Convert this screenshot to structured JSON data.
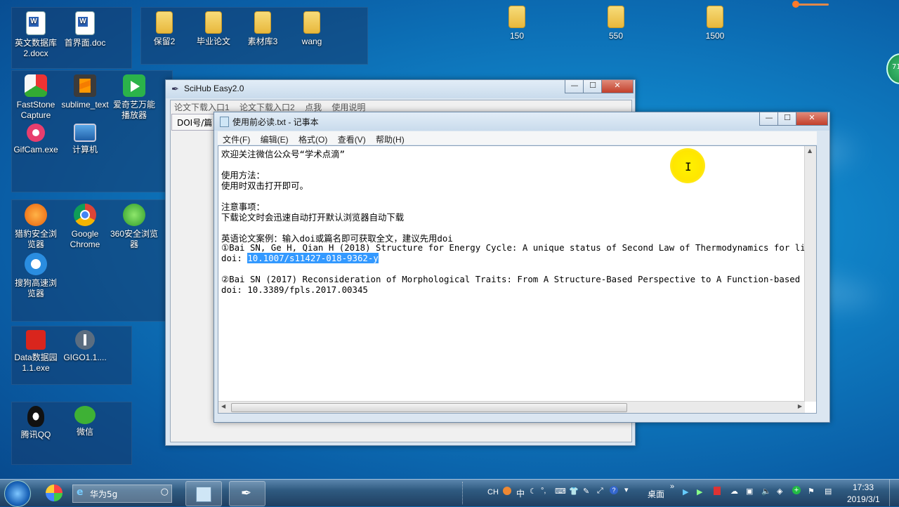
{
  "desktop": {
    "group1": [
      {
        "label_l1": "英文数据库",
        "label_l2": "2.docx",
        "icon": "word-doc-icon"
      },
      {
        "label_l1": "首界面.doc",
        "label_l2": "",
        "icon": "word-doc-icon"
      }
    ],
    "group2": [
      {
        "label": "保留2",
        "icon": "folder-icon"
      },
      {
        "label": "毕业论文",
        "icon": "folder-icon"
      },
      {
        "label": "素材库3",
        "icon": "folder-icon"
      },
      {
        "label": "wang",
        "icon": "folder-icon"
      }
    ],
    "loose_folders": [
      "150",
      "550",
      "1500"
    ],
    "group3": [
      {
        "label_l1": "FastStone",
        "label_l2": "Capture",
        "icon": "faststone-icon"
      },
      {
        "label_l1": "sublime_text",
        "label_l2": "",
        "icon": "sublime-icon"
      },
      {
        "label_l1": "爱奇艺万能",
        "label_l2": "播放器",
        "icon": "iqiyi-icon"
      },
      {
        "label_l1": "GifCam.exe",
        "label_l2": "",
        "icon": "gifcam-icon"
      },
      {
        "label_l1": "计算机",
        "label_l2": "",
        "icon": "computer-icon"
      }
    ],
    "group4": [
      {
        "label_l1": "猎豹安全浏",
        "label_l2": "览器",
        "icon": "liebao-icon"
      },
      {
        "label_l1": "Google",
        "label_l2": "Chrome",
        "icon": "chrome-icon"
      },
      {
        "label_l1": "360安全浏览",
        "label_l2": "器",
        "icon": "360-icon"
      },
      {
        "label_l1": "搜狗高速浏",
        "label_l2": "览器",
        "icon": "sogou-icon"
      }
    ],
    "group5": [
      {
        "label_l1": "Data数据园",
        "label_l2": "1.1.exe",
        "icon": "data-icon"
      },
      {
        "label_l1": "GIGO1.1....",
        "label_l2": "",
        "icon": "gigo-icon"
      }
    ],
    "group6": [
      {
        "label_l1": "腾讯QQ",
        "label_l2": "",
        "icon": "qq-icon"
      },
      {
        "label_l1": "微信",
        "label_l2": "",
        "icon": "wechat-icon"
      }
    ],
    "badge": "71"
  },
  "scihub": {
    "title": "SciHub Easy2.0",
    "menu": [
      "论文下载入口1",
      "论文下载入口2",
      "点我",
      "使用说明"
    ],
    "field_label": "DOI号/篇"
  },
  "notepad": {
    "title": "使用前必读.txt - 记事本",
    "menu": [
      "文件(F)",
      "编辑(E)",
      "格式(O)",
      "查看(V)",
      "帮助(H)"
    ],
    "lines": {
      "l1": "欢迎关注微信公众号“学术点滴”",
      "l3": "使用方法：",
      "l4": "使用时双击打开即可。",
      "l6": "注意事项：",
      "l7": "下载论文时会迅速自动打开默认浏览器自动下载",
      "l9": "英语论文案例：输入doi或篇名即可获取全文，建议先用doi",
      "l10": "①Bai SN, Ge H, Qian H (2018) Structure for Energy Cycle: A unique status of Second Law of Thermodynamics for liv",
      "l11_prefix": "doi: ",
      "l11_selected": "10.1007/s11427-018-9362-y",
      "l13": "②Bai SN (2017) Reconsideration of Morphological Traits: From A Structure-Based Perspective to A Function-based F",
      "l14": "doi: 10.3389/fpls.2017.00345"
    }
  },
  "taskbar": {
    "search_text": "华为5g",
    "ime": [
      "CH",
      "中"
    ],
    "desktop_label": "桌面",
    "time": "17:33",
    "date": "2019/3/1"
  }
}
